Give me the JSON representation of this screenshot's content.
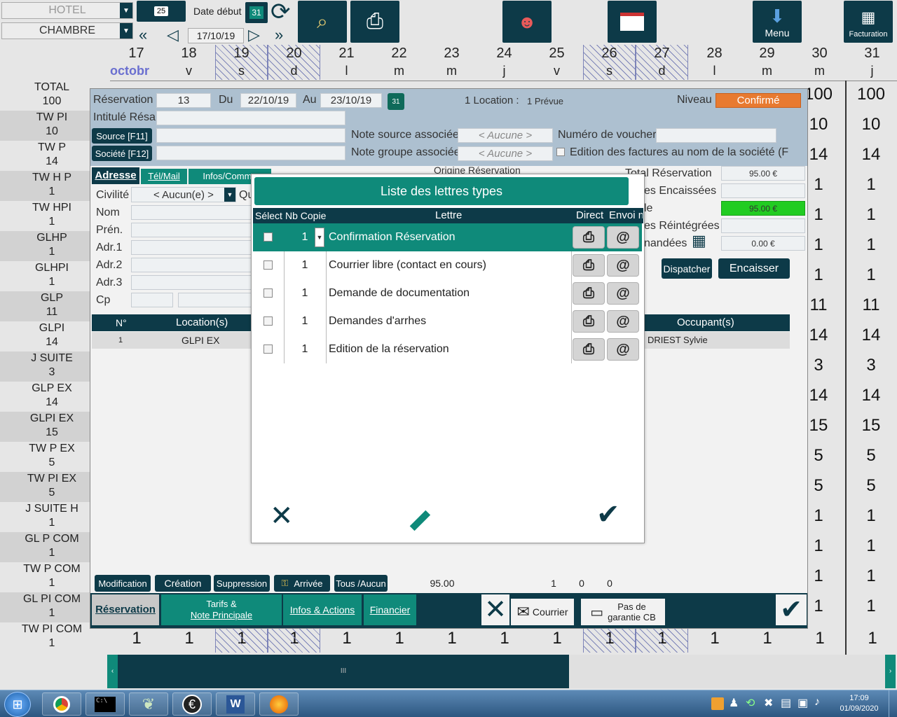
{
  "top": {
    "hotel": "HOTEL",
    "chambre": "CHAMBRE",
    "date_debut_label": "Date début",
    "date": "17/10/19",
    "calendar_day": "25",
    "cal_31": "31",
    "menu": "Menu",
    "facturation": "Facturation"
  },
  "days": [
    {
      "n": "17",
      "w": "octobr",
      "hatch": false,
      "month": true
    },
    {
      "n": "18",
      "w": "v",
      "hatch": false
    },
    {
      "n": "19",
      "w": "s",
      "hatch": true
    },
    {
      "n": "20",
      "w": "d",
      "hatch": true
    },
    {
      "n": "21",
      "w": "l",
      "hatch": false
    },
    {
      "n": "22",
      "w": "m",
      "hatch": false
    },
    {
      "n": "23",
      "w": "m",
      "hatch": false
    },
    {
      "n": "24",
      "w": "j",
      "hatch": false
    },
    {
      "n": "25",
      "w": "v",
      "hatch": false
    },
    {
      "n": "26",
      "w": "s",
      "hatch": true
    },
    {
      "n": "27",
      "w": "d",
      "hatch": true
    },
    {
      "n": "28",
      "w": "l",
      "hatch": false
    },
    {
      "n": "29",
      "w": "m",
      "hatch": false
    },
    {
      "n": "30",
      "w": "m",
      "hatch": false
    },
    {
      "n": "31",
      "w": "j",
      "hatch": false
    }
  ],
  "rows": [
    {
      "name": "TOTAL",
      "count": "100",
      "v30": "100",
      "v31": "100"
    },
    {
      "name": "TW PI",
      "count": "10",
      "v30": "10",
      "v31": "10"
    },
    {
      "name": "TW P",
      "count": "14",
      "v30": "14",
      "v31": "14"
    },
    {
      "name": "TW H P",
      "count": "1",
      "v30": "1",
      "v31": "1"
    },
    {
      "name": "TW HPI",
      "count": "1",
      "v30": "1",
      "v31": "1"
    },
    {
      "name": "GLHP",
      "count": "1",
      "v30": "1",
      "v31": "1"
    },
    {
      "name": "GLHPI",
      "count": "1",
      "v30": "1",
      "v31": "1"
    },
    {
      "name": "GLP",
      "count": "11",
      "v30": "11",
      "v31": "11"
    },
    {
      "name": "GLPI",
      "count": "14",
      "v30": "14",
      "v31": "14"
    },
    {
      "name": "J SUITE",
      "count": "3",
      "v30": "3",
      "v31": "3"
    },
    {
      "name": "GLP EX",
      "count": "14",
      "v30": "14",
      "v31": "14"
    },
    {
      "name": "GLPI EX",
      "count": "15",
      "v30": "15",
      "v31": "15"
    },
    {
      "name": "TW P EX",
      "count": "5",
      "v30": "5",
      "v31": "5"
    },
    {
      "name": "TW PI EX",
      "count": "5",
      "v30": "5",
      "v31": "5"
    },
    {
      "name": "J SUITE H",
      "count": "1",
      "v30": "1",
      "v31": "1"
    },
    {
      "name": "GL P COM",
      "count": "1",
      "v30": "1",
      "v31": "1"
    },
    {
      "name": "TW P COM",
      "count": "1",
      "v30": "1",
      "v31": "1"
    },
    {
      "name": "GL PI COM",
      "count": "1",
      "v30": "1",
      "v31": "1"
    },
    {
      "name": "TW PI COM",
      "count": "1",
      "v30": "1",
      "v31": "1"
    }
  ],
  "bottom_row": [
    "1",
    "1",
    "1",
    "1",
    "1",
    "1",
    "1",
    "1",
    "1",
    "1",
    "1",
    "1",
    "1",
    "1",
    "1"
  ],
  "resa": {
    "reservation_label": "Réservation",
    "reservation_no": "13",
    "du_label": "Du",
    "du": "22/10/19",
    "au_label": "Au",
    "au": "23/10/19",
    "cal": "31",
    "location_count": "1 Location :",
    "location_status": "1 Prévue",
    "niveau_label": "Niveau",
    "niveau": "Confirmé",
    "intitule_label": "Intitulé Résa",
    "source_btn": "Source [F11]",
    "societe_btn": "Société [F12]",
    "note_source_label": "Note source associée",
    "note_source": "< Aucune >",
    "note_groupe_label": "Note groupe associée",
    "note_groupe": "< Aucune >",
    "voucher_label": "Numéro de voucher",
    "edition_label": "Edition des factures au nom de la société (F",
    "tab_adresse": "Adresse",
    "tab_tel": "Tél/Mail",
    "tab_infos": "Infos/Comme",
    "origine_label": "Origine Réservation",
    "civilite_label": "Civilité",
    "civilite": "< Aucun(e) >",
    "qu_label": "Qu",
    "nom_label": "Nom",
    "prenom_label": "Prén.",
    "adr1_label": "Adr.1",
    "adr2_label": "Adr.2",
    "adr3_label": "Adr.3",
    "cp_label": "Cp",
    "total_resa_label": "Total Réservation",
    "total_resa": "95.00 €",
    "encaissees_label": "es Encaissées",
    "solde_label": "le",
    "solde": "95.00 €",
    "reintegrees_label": "es Réintégrées",
    "demandees_label": "nandées",
    "demandees": "0.00 €",
    "dispatcher": "Dispatcher",
    "encaisser": "Encaisser",
    "col_no": "N°",
    "col_location": "Location(s)",
    "col_occupant": "Occupant(s)",
    "loc_no": "1",
    "loc_name": "GLPI EX",
    "occupant": "DRIEST Sylvie",
    "btn_modification": "Modification",
    "btn_creation": "Création",
    "btn_suppression": "Suppression",
    "btn_arrivee": "Arrivée",
    "btn_tous": "Tous /Aucun",
    "sum_total": "95.00",
    "sum_a": "1",
    "sum_b": "0",
    "sum_c": "0",
    "tab_reservation": "Réservation",
    "tab_tarifs_1": "Tarifs &",
    "tab_tarifs_2": "Note Principale",
    "tab_infos_actions": "Infos & Actions",
    "tab_financier": "Financier",
    "btn_courrier": "Courrier",
    "btn_garantie_1": "Pas de",
    "btn_garantie_2": "garantie CB"
  },
  "modal": {
    "title": "Liste des lettres types",
    "col_select": "Sélect",
    "col_copies": "Nb Copie",
    "col_lettre": "Lettre",
    "col_direct": "Direct",
    "col_envoi": "Envoi m",
    "letters": [
      {
        "copies": "1",
        "name": "Confirmation Réservation",
        "selected": true
      },
      {
        "copies": "1",
        "name": "Courrier libre (contact en cours)",
        "selected": false
      },
      {
        "copies": "1",
        "name": "Demande de documentation",
        "selected": false
      },
      {
        "copies": "1",
        "name": "Demandes d'arrhes",
        "selected": false
      },
      {
        "copies": "1",
        "name": "Edition de la réservation",
        "selected": false
      }
    ]
  },
  "taskbar": {
    "time": "17:09",
    "date": "01/09/2020"
  },
  "colors": {
    "dark_teal": "#0d3a48",
    "teal": "#0f8a7a",
    "header_blue": "#adc0d0",
    "confirm_orange": "#e87a30",
    "green": "#22cc22",
    "month_blue": "#6a6fd0"
  }
}
